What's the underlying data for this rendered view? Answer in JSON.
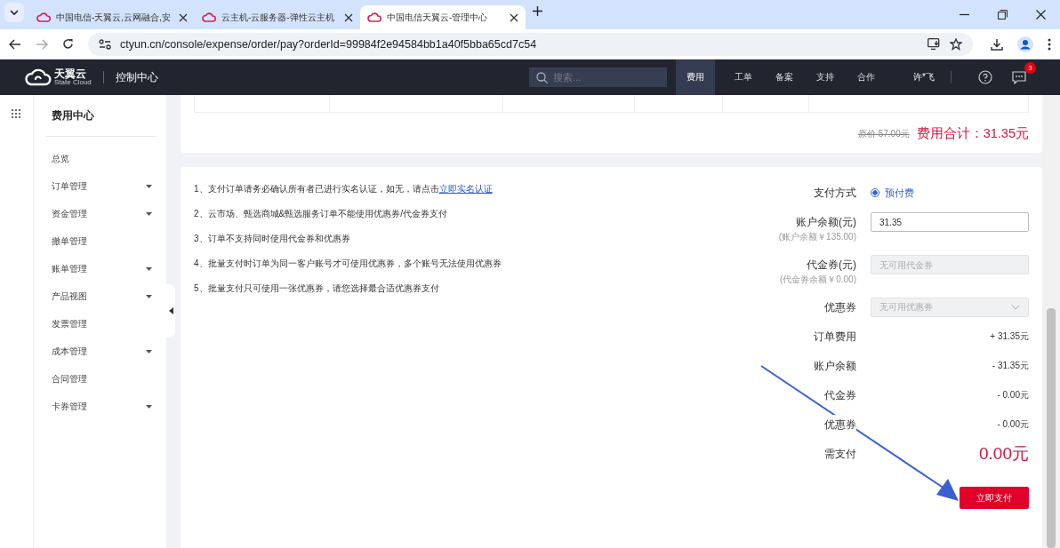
{
  "browser": {
    "tabs": [
      {
        "title": "中国电信-天翼云,云网融合,安",
        "selected": false
      },
      {
        "title": "云主机-云服务器-弹性云主机",
        "selected": false
      },
      {
        "title": "中国电信天翼云-管理中心",
        "selected": true
      }
    ],
    "url": "ctyun.cn/console/expense/order/pay?orderId=99984f2e94584bb1a40f5bba65cd7c54"
  },
  "header": {
    "logo_name": "天翼云",
    "logo_sub": "State Cloud",
    "console": "控制中心",
    "search_placeholder": "搜索...",
    "nav": [
      {
        "label": "费用",
        "selected": true
      },
      {
        "label": "工单",
        "selected": false
      },
      {
        "label": "备案",
        "selected": false
      },
      {
        "label": "支持",
        "selected": false
      },
      {
        "label": "合作",
        "selected": false
      }
    ],
    "user": "许*飞",
    "message_badge": "3"
  },
  "sidebar": {
    "title": "费用中心",
    "items": [
      {
        "label": "总览",
        "has_submenu": false
      },
      {
        "label": "订单管理",
        "has_submenu": true
      },
      {
        "label": "资金管理",
        "has_submenu": true
      },
      {
        "label": "撤单管理",
        "has_submenu": false
      },
      {
        "label": "账单管理",
        "has_submenu": true
      },
      {
        "label": "产品视图",
        "has_submenu": true
      },
      {
        "label": "发票管理",
        "has_submenu": false
      },
      {
        "label": "成本管理",
        "has_submenu": true
      },
      {
        "label": "合同管理",
        "has_submenu": false
      },
      {
        "label": "卡券管理",
        "has_submenu": true
      }
    ]
  },
  "summary": {
    "original_price": "原价 57.00元",
    "total": "费用合计：31.35元"
  },
  "notes": [
    {
      "text": "1、支付订单请务必确认所有者已进行实名认证，如无，请点击",
      "link": "立即实名认证"
    },
    {
      "text": "2、云市场、甄选商城&甄选服务订单不能使用优惠券/代金券支付"
    },
    {
      "text": "3、订单不支持同时使用代金券和优惠券"
    },
    {
      "text": "4、批量支付时订单为同一客户账号才可使用优惠券，多个账号无法使用优惠券"
    },
    {
      "text": "5、批量支付只可使用一张优惠券，请您选择最合适优惠券支付"
    }
  ],
  "payment": {
    "method_label": "支付方式",
    "methods": [
      {
        "label": "预付费",
        "selected": true
      }
    ],
    "fields": [
      {
        "kind": "input",
        "label": "账户余额(元)",
        "sub": "(账户余额￥135.00)",
        "value": "31.35",
        "disabled": false
      },
      {
        "kind": "input",
        "label": "代金券(元)",
        "sub": "(代金券余额￥0.00)",
        "placeholder": "无可用代金券",
        "disabled": true
      },
      {
        "kind": "select",
        "label": "优惠券",
        "placeholder": "无可用优惠券",
        "disabled": true
      }
    ],
    "breakdown": [
      {
        "label": "订单费用",
        "value": "+ 31.35元"
      },
      {
        "label": "账户余额",
        "value": "- 31.35元"
      },
      {
        "label": "代金券",
        "value": "- 0.00元"
      },
      {
        "label": "优惠券",
        "value": "- 0.00元"
      }
    ],
    "due_label": "需支付",
    "due_value": "0.00元",
    "pay_button": "立即支付"
  }
}
